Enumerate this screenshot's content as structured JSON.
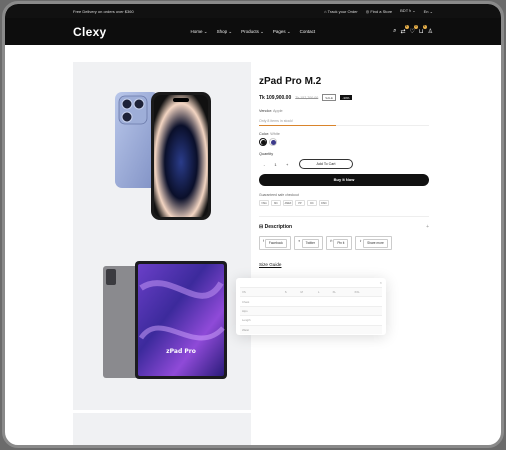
{
  "topbar": {
    "promo": "Free Delivery on orders over $360",
    "track": "Track your Order",
    "store": "Find a Store",
    "currency": "BDT ৳ ⌄",
    "language": "En ⌄"
  },
  "header": {
    "logo": "Clexy",
    "nav": [
      "Home ⌄",
      "Shop ⌄",
      "Products ⌄",
      "Pages ⌄",
      "Contact"
    ],
    "badges": {
      "compare": "0",
      "wishlist": "0",
      "cart": "0"
    }
  },
  "product": {
    "title": "zPad Pro M.2",
    "price": "Tk 109,900.00",
    "old_price": "Tk 157,700.00",
    "sale_label": "SALE",
    "discount": "-30%",
    "vendor_label": "Vendor:",
    "vendor": "Apple",
    "stock_text": "Only 8 items in stock!",
    "stock_fraction": 0.45,
    "color_label": "Color:",
    "color_value": "White",
    "swatch_colors": [
      "#111111",
      "#3c3a8a"
    ],
    "quantity_label": "Quantity",
    "qty_minus": "-",
    "qty_value": "1",
    "qty_plus": "+",
    "add_to_cart": "Add To Cart",
    "buy_now": "Buy It Now",
    "guarantee": "Guaranteed safe checkout",
    "payments": [
      "VISA",
      "MC",
      "AMEX",
      "PP",
      "DC",
      "DISC"
    ],
    "description_label": "Description",
    "share": [
      "Facebook",
      "Twitter",
      "Pin it",
      "Share more"
    ],
    "size_guide": "Size Guide",
    "tablet_screen_text": "zPad Pro"
  },
  "size_table": {
    "rows": [
      [
        "XS",
        "S",
        "M",
        "L",
        "XL",
        "XXL"
      ],
      [
        "Chest",
        "",
        "",
        "",
        "",
        ""
      ],
      [
        "Hips",
        "",
        "",
        "",
        "",
        ""
      ],
      [
        "Length",
        "",
        "",
        "",
        "",
        ""
      ],
      [
        "Waist",
        "",
        "",
        "",
        "",
        ""
      ]
    ]
  }
}
